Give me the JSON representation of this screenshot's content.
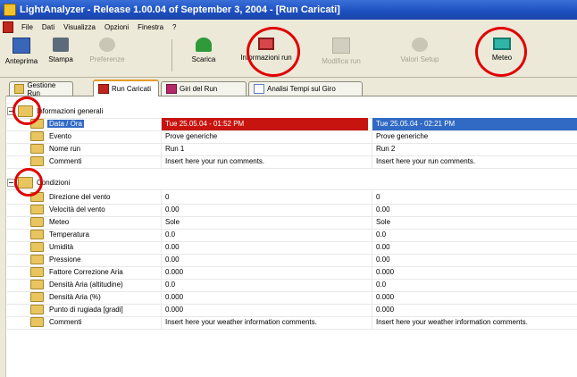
{
  "window": {
    "title": "LightAnalyzer  -  Release 1.00.04 of September 3, 2004 - [Run Caricati]"
  },
  "menu": {
    "items": [
      "File",
      "Dati",
      "Visualizza",
      "Opzioni",
      "Finestra",
      "?"
    ]
  },
  "toolbar": {
    "preview_label": "Anteprima",
    "print_label": "Stampa",
    "disabled1_label": "Preferenze",
    "unload_label": "Scarica",
    "runinfo_label": "Informazioni run",
    "disabled2_label": "Modifica run",
    "disabled3_label": "Valori Setup",
    "meteo_label": "Meteo"
  },
  "tabs": [
    {
      "label": "Gestione Run"
    },
    {
      "label": "Run Caricati"
    },
    {
      "label": "Giri del Run"
    },
    {
      "label": "Analisi Tempi sul Giro"
    }
  ],
  "grid": {
    "section_general": "Informazioni generali",
    "section_conditions": "Condizioni",
    "general_rows": [
      {
        "label": "Data / Ora",
        "run1": "Tue 25.05.04 - 01:52 PM",
        "run2": "Tue 25.05.04 - 02:21 PM"
      },
      {
        "label": "Evento",
        "run1": "Prove generiche",
        "run2": "Prove generiche"
      },
      {
        "label": "Nome run",
        "run1": "Run 1",
        "run2": "Run 2"
      },
      {
        "label": "Commenti",
        "run1": "Insert here your run comments.",
        "run2": "Insert here your run comments."
      }
    ],
    "condition_rows": [
      {
        "label": "Direzione del vento",
        "run1": "0",
        "run2": "0"
      },
      {
        "label": "Velocità del vento",
        "run1": "0.00",
        "run2": "0.00"
      },
      {
        "label": "Meteo",
        "run1": "Sole",
        "run2": "Sole"
      },
      {
        "label": "Temperatura",
        "run1": "0.0",
        "run2": "0.0"
      },
      {
        "label": "Umidità",
        "run1": "0.00",
        "run2": "0.00"
      },
      {
        "label": "Pressione",
        "run1": "0.00",
        "run2": "0.00"
      },
      {
        "label": "Fattore Correzione Aria",
        "run1": "0.000",
        "run2": "0.000"
      },
      {
        "label": "Densità Aria (altitudine)",
        "run1": "0.0",
        "run2": "0.0"
      },
      {
        "label": "Densità Aria (%)",
        "run1": "0.000",
        "run2": "0.000"
      },
      {
        "label": "Punto di rugiada [gradi]",
        "run1": "0.000",
        "run2": "0.000"
      },
      {
        "label": "Commenti",
        "run1": "Insert here your weather information comments.",
        "run2": "Insert here your weather information comments."
      }
    ]
  },
  "colors": {
    "highlight_red": "#c8140e",
    "highlight_blue": "#316ac5",
    "annotation_circle": "#e00000"
  }
}
